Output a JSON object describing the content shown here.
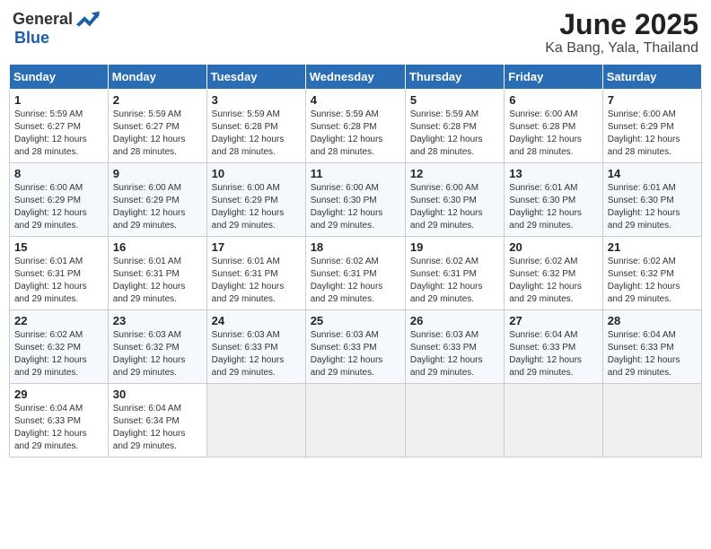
{
  "logo": {
    "general": "General",
    "blue": "Blue"
  },
  "title": {
    "month_year": "June 2025",
    "location": "Ka Bang, Yala, Thailand"
  },
  "days_of_week": [
    "Sunday",
    "Monday",
    "Tuesday",
    "Wednesday",
    "Thursday",
    "Friday",
    "Saturday"
  ],
  "weeks": [
    [
      {
        "day": "1",
        "sunrise": "5:59 AM",
        "sunset": "6:27 PM",
        "daylight": "12 hours and 28 minutes."
      },
      {
        "day": "2",
        "sunrise": "5:59 AM",
        "sunset": "6:27 PM",
        "daylight": "12 hours and 28 minutes."
      },
      {
        "day": "3",
        "sunrise": "5:59 AM",
        "sunset": "6:28 PM",
        "daylight": "12 hours and 28 minutes."
      },
      {
        "day": "4",
        "sunrise": "5:59 AM",
        "sunset": "6:28 PM",
        "daylight": "12 hours and 28 minutes."
      },
      {
        "day": "5",
        "sunrise": "5:59 AM",
        "sunset": "6:28 PM",
        "daylight": "12 hours and 28 minutes."
      },
      {
        "day": "6",
        "sunrise": "6:00 AM",
        "sunset": "6:28 PM",
        "daylight": "12 hours and 28 minutes."
      },
      {
        "day": "7",
        "sunrise": "6:00 AM",
        "sunset": "6:29 PM",
        "daylight": "12 hours and 28 minutes."
      }
    ],
    [
      {
        "day": "8",
        "sunrise": "6:00 AM",
        "sunset": "6:29 PM",
        "daylight": "12 hours and 29 minutes."
      },
      {
        "day": "9",
        "sunrise": "6:00 AM",
        "sunset": "6:29 PM",
        "daylight": "12 hours and 29 minutes."
      },
      {
        "day": "10",
        "sunrise": "6:00 AM",
        "sunset": "6:29 PM",
        "daylight": "12 hours and 29 minutes."
      },
      {
        "day": "11",
        "sunrise": "6:00 AM",
        "sunset": "6:30 PM",
        "daylight": "12 hours and 29 minutes."
      },
      {
        "day": "12",
        "sunrise": "6:00 AM",
        "sunset": "6:30 PM",
        "daylight": "12 hours and 29 minutes."
      },
      {
        "day": "13",
        "sunrise": "6:01 AM",
        "sunset": "6:30 PM",
        "daylight": "12 hours and 29 minutes."
      },
      {
        "day": "14",
        "sunrise": "6:01 AM",
        "sunset": "6:30 PM",
        "daylight": "12 hours and 29 minutes."
      }
    ],
    [
      {
        "day": "15",
        "sunrise": "6:01 AM",
        "sunset": "6:31 PM",
        "daylight": "12 hours and 29 minutes."
      },
      {
        "day": "16",
        "sunrise": "6:01 AM",
        "sunset": "6:31 PM",
        "daylight": "12 hours and 29 minutes."
      },
      {
        "day": "17",
        "sunrise": "6:01 AM",
        "sunset": "6:31 PM",
        "daylight": "12 hours and 29 minutes."
      },
      {
        "day": "18",
        "sunrise": "6:02 AM",
        "sunset": "6:31 PM",
        "daylight": "12 hours and 29 minutes."
      },
      {
        "day": "19",
        "sunrise": "6:02 AM",
        "sunset": "6:31 PM",
        "daylight": "12 hours and 29 minutes."
      },
      {
        "day": "20",
        "sunrise": "6:02 AM",
        "sunset": "6:32 PM",
        "daylight": "12 hours and 29 minutes."
      },
      {
        "day": "21",
        "sunrise": "6:02 AM",
        "sunset": "6:32 PM",
        "daylight": "12 hours and 29 minutes."
      }
    ],
    [
      {
        "day": "22",
        "sunrise": "6:02 AM",
        "sunset": "6:32 PM",
        "daylight": "12 hours and 29 minutes."
      },
      {
        "day": "23",
        "sunrise": "6:03 AM",
        "sunset": "6:32 PM",
        "daylight": "12 hours and 29 minutes."
      },
      {
        "day": "24",
        "sunrise": "6:03 AM",
        "sunset": "6:33 PM",
        "daylight": "12 hours and 29 minutes."
      },
      {
        "day": "25",
        "sunrise": "6:03 AM",
        "sunset": "6:33 PM",
        "daylight": "12 hours and 29 minutes."
      },
      {
        "day": "26",
        "sunrise": "6:03 AM",
        "sunset": "6:33 PM",
        "daylight": "12 hours and 29 minutes."
      },
      {
        "day": "27",
        "sunrise": "6:04 AM",
        "sunset": "6:33 PM",
        "daylight": "12 hours and 29 minutes."
      },
      {
        "day": "28",
        "sunrise": "6:04 AM",
        "sunset": "6:33 PM",
        "daylight": "12 hours and 29 minutes."
      }
    ],
    [
      {
        "day": "29",
        "sunrise": "6:04 AM",
        "sunset": "6:33 PM",
        "daylight": "12 hours and 29 minutes."
      },
      {
        "day": "30",
        "sunrise": "6:04 AM",
        "sunset": "6:34 PM",
        "daylight": "12 hours and 29 minutes."
      },
      null,
      null,
      null,
      null,
      null
    ]
  ],
  "labels": {
    "sunrise": "Sunrise:",
    "sunset": "Sunset:",
    "daylight": "Daylight:"
  }
}
